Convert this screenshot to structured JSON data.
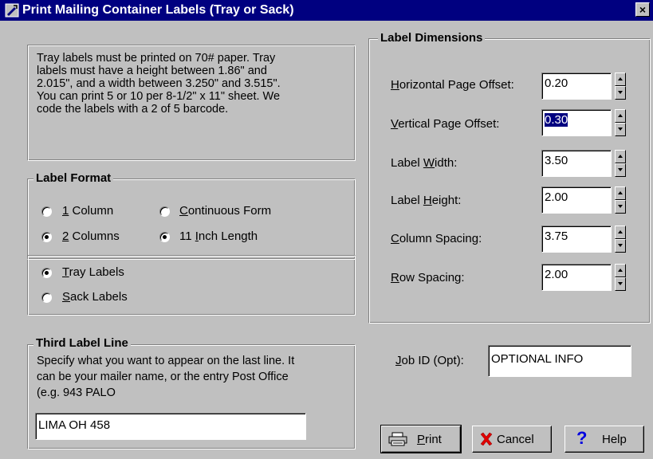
{
  "window": {
    "title": "Print Mailing Container Labels (Tray or Sack)",
    "close": "×"
  },
  "info": {
    "lines": [
      "Tray labels must be printed on 70# paper.  Tray",
      "labels must have a height between 1.86\" and",
      "2.015\",  and a width between 3.250\" and 3.515\".",
      "You can print 5 or 10 per 8-1/2\" x 11\" sheet.  We",
      "code the labels with a 2 of 5 barcode."
    ]
  },
  "label_format": {
    "title": "Label Format",
    "columns": {
      "one": "1 Column",
      "two": "2 Columns",
      "selected": "2 Columns"
    },
    "form": {
      "continuous": "Continuous Form",
      "eleven": "11 Inch Length",
      "selected": "11 Inch Length"
    },
    "type": {
      "tray": "Tray Labels",
      "sack": "Sack Labels",
      "selected": "Tray Labels"
    }
  },
  "third_line": {
    "title": "Third Label Line",
    "desc": [
      "Specify what you want to appear on the last line.  It",
      "can be your mailer name, or the entry Post Office",
      "(e.g. 943 PALO"
    ],
    "value": "LIMA OH 458"
  },
  "dimensions": {
    "title": "Label Dimensions",
    "fields": [
      {
        "label": "Horizontal Page Offset:",
        "value": "0.20"
      },
      {
        "label": "Vertical Page Offset:",
        "value": "0.30"
      },
      {
        "label": "Label Width:",
        "value": "3.50"
      },
      {
        "label": "Label Height:",
        "value": "2.00"
      },
      {
        "label": "Column Spacing:",
        "value": "3.75"
      },
      {
        "label": "Row Spacing:",
        "value": "2.00"
      }
    ]
  },
  "job": {
    "label": "Job ID (Opt):",
    "value": "OPTIONAL INFO"
  },
  "buttons": {
    "print": "Print",
    "cancel": "Cancel",
    "help": "Help"
  }
}
